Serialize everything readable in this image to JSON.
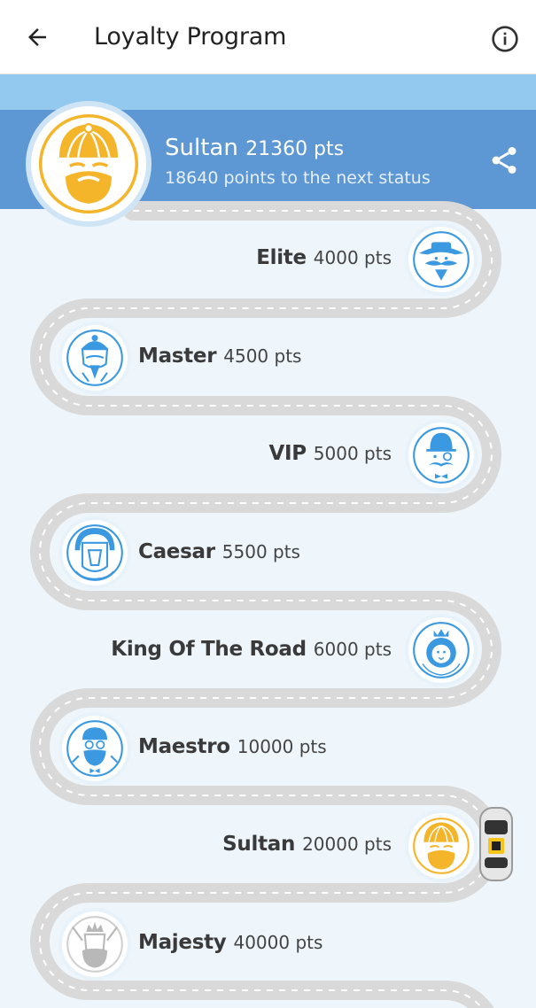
{
  "appbar": {
    "title": "Loyalty Program",
    "back_icon": "arrow-left-icon",
    "info_icon": "info-icon"
  },
  "current": {
    "status": "Sultan",
    "points": "21360 pts",
    "next_text": "18640 points to the next status",
    "share_icon": "share-icon"
  },
  "levels": [
    {
      "name": "Elite",
      "points": "4000 pts",
      "icon": "cowboy-mustache-icon"
    },
    {
      "name": "Master",
      "points": "4500 pts",
      "icon": "wise-master-icon"
    },
    {
      "name": "VIP",
      "points": "5000 pts",
      "icon": "bowler-hat-monocle-icon"
    },
    {
      "name": "Caesar",
      "points": "5500 pts",
      "icon": "roman-helmet-icon"
    },
    {
      "name": "King Of The Road",
      "points": "6000 pts",
      "icon": "lion-crown-icon"
    },
    {
      "name": "Maestro",
      "points": "10000 pts",
      "icon": "maestro-conductor-icon"
    },
    {
      "name": "Sultan",
      "points": "20000 pts",
      "icon": "sultan-turban-icon"
    },
    {
      "name": "Majesty",
      "points": "40000 pts",
      "icon": "king-crown-icon"
    }
  ],
  "colors": {
    "banner": "#5d97d4",
    "strip": "#93c9ef",
    "background": "#eef6fb",
    "road": "#d9d9d9",
    "icon_blue": "#3a99e0",
    "icon_gold": "#f5b52a",
    "locked_gray": "#b8b8b8"
  }
}
